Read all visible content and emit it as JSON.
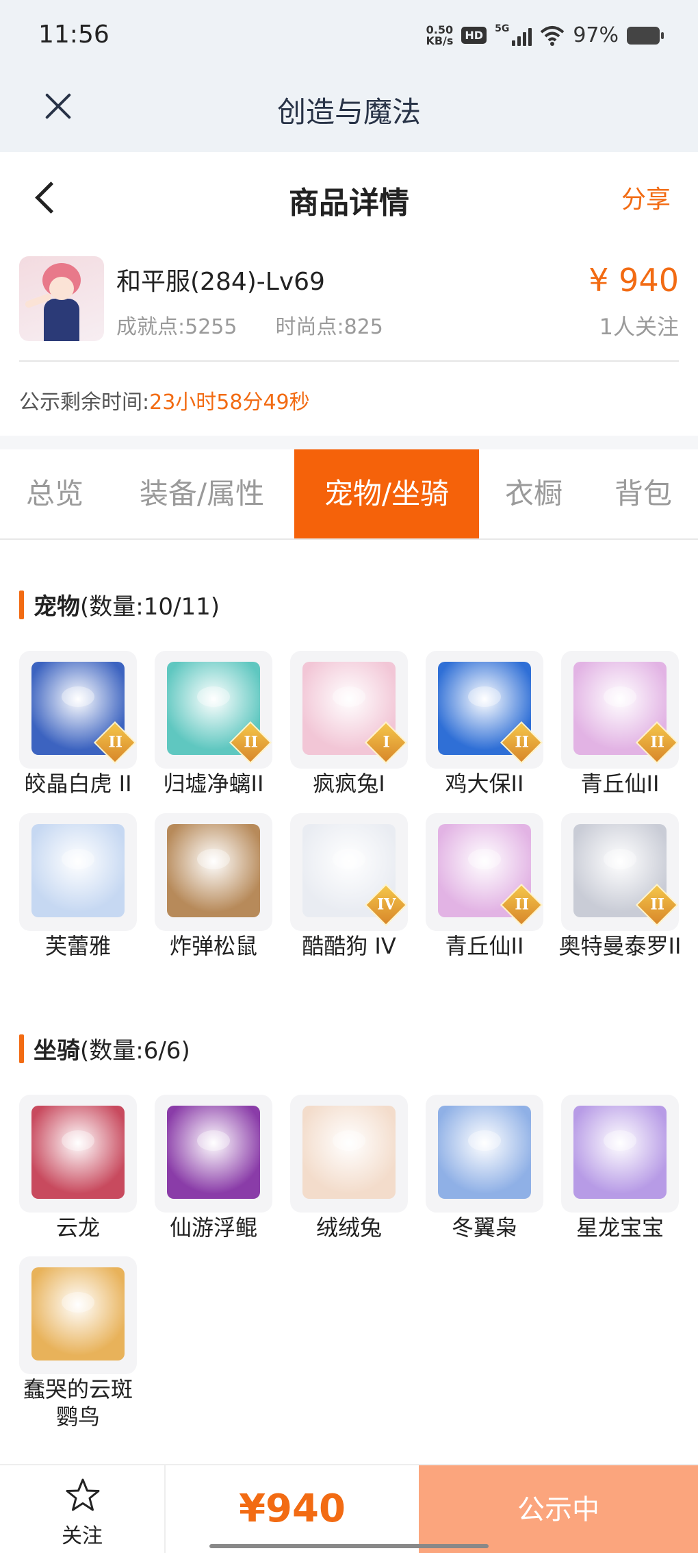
{
  "status_bar": {
    "time": "11:56",
    "speed_value": "0.50",
    "speed_unit": "KB/s",
    "hd": "HD",
    "network": "5G",
    "battery": "97%"
  },
  "top_bar": {
    "title": "创造与魔法"
  },
  "nav_bar": {
    "title": "商品详情",
    "share": "分享"
  },
  "product": {
    "name": "和平服(284)-Lv69",
    "achievement": "成就点:5255",
    "fashion": "时尚点:825",
    "price": "¥ 940",
    "followers": "1人关注"
  },
  "countdown": {
    "label": "公示剩余时间:",
    "value": "23小时58分49秒"
  },
  "tabs": [
    {
      "label": "总览"
    },
    {
      "label": "装备/属性"
    },
    {
      "label": "宠物/坐骑",
      "active": true
    },
    {
      "label": "衣橱"
    },
    {
      "label": "背包"
    }
  ],
  "pets": {
    "title": "宠物",
    "count": "(数量:10/11)",
    "items": [
      {
        "label": "皎晶白虎 II",
        "badge": "II",
        "color": "#3c63c0"
      },
      {
        "label": "归墟净螭II",
        "badge": "II",
        "color": "#5fc7c0"
      },
      {
        "label": "疯疯兔I",
        "badge": "I",
        "color": "#f2c6d6"
      },
      {
        "label": "鸡大保II",
        "badge": "II",
        "color": "#2f6fd6"
      },
      {
        "label": "青丘仙II",
        "badge": "II",
        "color": "#e2b3e4"
      },
      {
        "label": "芙蕾雅",
        "badge": "",
        "color": "#c6d8f2"
      },
      {
        "label": "炸弹松鼠",
        "badge": "",
        "color": "#b78a5a"
      },
      {
        "label": "酷酷狗 IV",
        "badge": "IV",
        "color": "#e9ecf2"
      },
      {
        "label": "青丘仙II",
        "badge": "II",
        "color": "#e2b3e4"
      },
      {
        "label": "奥特曼泰罗II",
        "badge": "II",
        "color": "#c9ccd6"
      }
    ]
  },
  "mounts": {
    "title": "坐骑",
    "count": "(数量:6/6)",
    "items": [
      {
        "label": "云龙",
        "color": "#c84a5e"
      },
      {
        "label": "仙游浮鲲",
        "color": "#8a3ca8"
      },
      {
        "label": "绒绒兔",
        "color": "#f3dccb"
      },
      {
        "label": "冬翼枭",
        "color": "#8fb0e6"
      },
      {
        "label": "星龙宝宝",
        "color": "#b79be6"
      },
      {
        "label": "蠢哭的云斑鹦鸟",
        "color": "#e8b25a"
      }
    ]
  },
  "bottom_bar": {
    "follow": "关注",
    "price": "¥940",
    "status": "公示中"
  }
}
